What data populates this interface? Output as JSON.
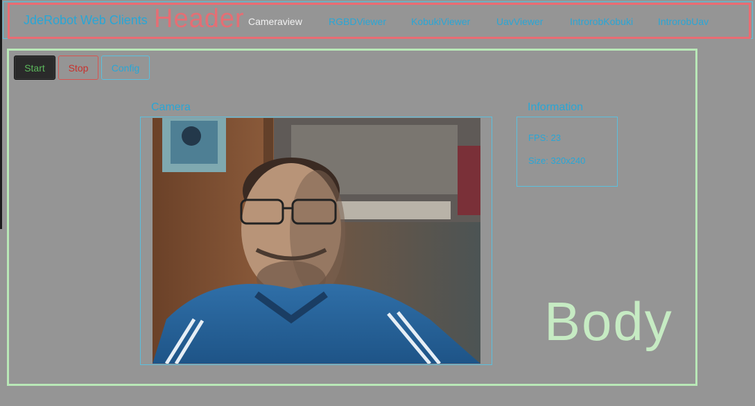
{
  "header": {
    "brand": "JdeRobot Web Clients",
    "overlay_label": "Header",
    "nav_partial": "...",
    "nav": [
      {
        "label": "Cameraview",
        "active": true
      },
      {
        "label": "RGBDViewer",
        "active": false
      },
      {
        "label": "KobukiViewer",
        "active": false
      },
      {
        "label": "UavViewer",
        "active": false
      },
      {
        "label": "IntrorobKobuki",
        "active": false
      },
      {
        "label": "IntrorobUav",
        "active": false
      }
    ]
  },
  "body": {
    "overlay_label": "Body",
    "buttons": {
      "start": "Start",
      "stop": "Stop",
      "config": "Config"
    },
    "camera": {
      "title": "Camera"
    },
    "information": {
      "title": "Information",
      "fps": "FPS: 23",
      "size": "Size: 320x240"
    }
  },
  "colors": {
    "background": "#959595",
    "header_border": "#ea6c73",
    "body_border": "#b9e8b7",
    "accent_blue": "#29a6d6",
    "info_border": "#5bc0de"
  }
}
